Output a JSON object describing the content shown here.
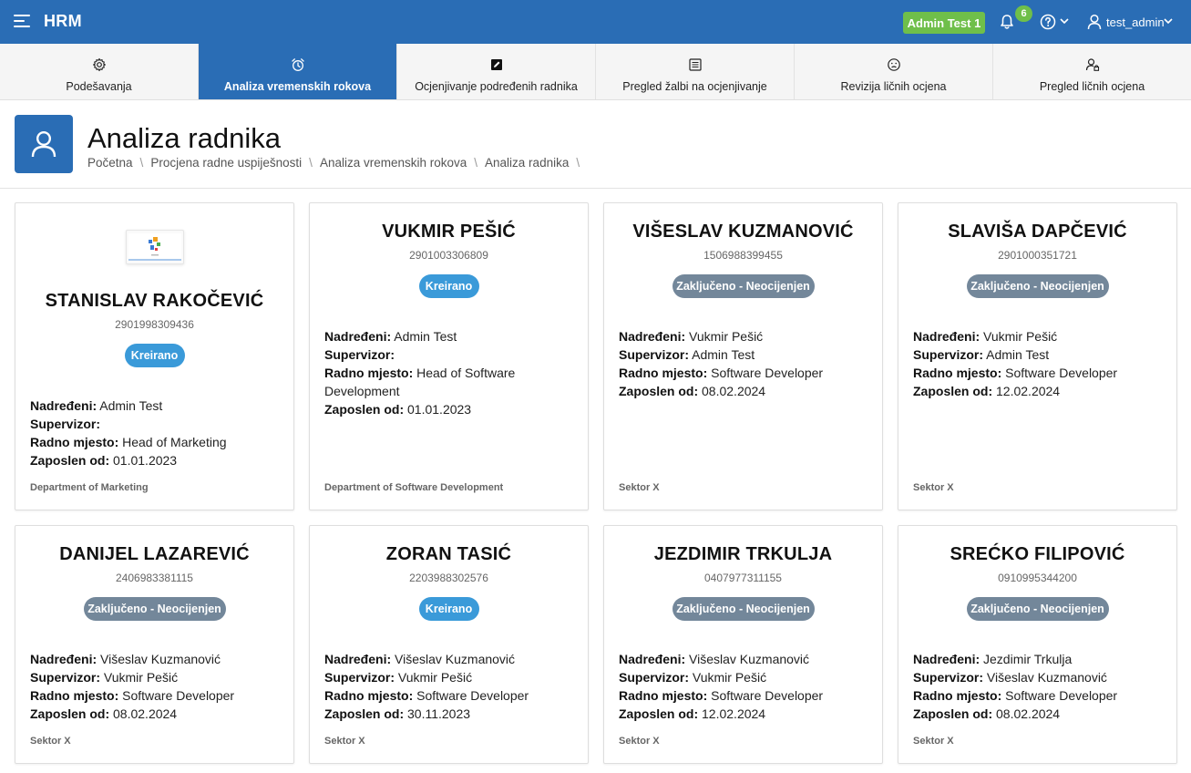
{
  "header": {
    "brand": "HRM",
    "admin_badge": "Admin Test 1",
    "notification_count": "6",
    "user_name": "test_admin",
    "accent_color": "#2a6db5"
  },
  "tabs": [
    {
      "label": "Podešavanja",
      "icon": "gear-icon",
      "active": false
    },
    {
      "label": "Analiza vremenskih rokova",
      "icon": "alarm-clock-icon",
      "active": true
    },
    {
      "label": "Ocjenjivanje podređenih radnika",
      "icon": "edit-icon",
      "active": false
    },
    {
      "label": "Pregled žalbi na ocjenjivanje",
      "icon": "list-icon",
      "active": false
    },
    {
      "label": "Revizija ličnih ocjena",
      "icon": "sad-face-icon",
      "active": false
    },
    {
      "label": "Pregled ličnih ocjena",
      "icon": "user-lock-icon",
      "active": false
    }
  ],
  "page": {
    "title": "Analiza radnika",
    "breadcrumb": [
      "Početna",
      "Procjena radne uspiješnosti",
      "Analiza vremenskih rokova",
      "Analiza radnika"
    ]
  },
  "labels": {
    "nadredjeni": "Nadređeni:",
    "supervizor": "Supervizor:",
    "radno_mjesto": "Radno mjesto:",
    "zaposlen_od": "Zaposlen od:"
  },
  "cards": [
    {
      "name": "STANISLAV RAKOČEVIĆ",
      "id": "2901998309436",
      "status": "Kreirano",
      "nadredjeni": "Admin Test",
      "supervizor": "",
      "radno_mjesto": "Head of Marketing",
      "zaposlen_od": "01.01.2023",
      "dept": "Department of Marketing"
    },
    {
      "name": "VUKMIR PEŠIĆ",
      "id": "2901003306809",
      "status": "Kreirano",
      "nadredjeni": "Admin Test",
      "supervizor": "",
      "radno_mjesto": "Head of Software Development",
      "zaposlen_od": "01.01.2023",
      "dept": "Department of Software Development"
    },
    {
      "name": "VIŠESLAV KUZMANOVIĆ",
      "id": "1506988399455",
      "status": "Zaključeno - Neocijenjen",
      "nadredjeni": "Vukmir Pešić",
      "supervizor": "Admin Test",
      "radno_mjesto": "Software Developer",
      "zaposlen_od": "08.02.2024",
      "dept": "Sektor X"
    },
    {
      "name": "SLAVIŠA DAPČEVIĆ",
      "id": "2901000351721",
      "status": "Zaključeno - Neocijenjen",
      "nadredjeni": "Vukmir Pešić",
      "supervizor": "Admin Test",
      "radno_mjesto": "Software Developer",
      "zaposlen_od": "12.02.2024",
      "dept": "Sektor X"
    },
    {
      "name": "DANIJEL LAZAREVIĆ",
      "id": "2406983381115",
      "status": "Zaključeno - Neocijenjen",
      "nadredjeni": "Višeslav Kuzmanović",
      "supervizor": "Vukmir Pešić",
      "radno_mjesto": "Software Developer",
      "zaposlen_od": "08.02.2024",
      "dept": "Sektor X"
    },
    {
      "name": "ZORAN TASIĆ",
      "id": "2203988302576",
      "status": "Kreirano",
      "nadredjeni": "Višeslav Kuzmanović",
      "supervizor": "Vukmir Pešić",
      "radno_mjesto": "Software Developer",
      "zaposlen_od": "30.11.2023",
      "dept": "Sektor X"
    },
    {
      "name": "JEZDIMIR TRKULJA",
      "id": "0407977311155",
      "status": "Zaključeno - Neocijenjen",
      "nadredjeni": "Višeslav Kuzmanović",
      "supervizor": "Vukmir Pešić",
      "radno_mjesto": "Software Developer",
      "zaposlen_od": "12.02.2024",
      "dept": "Sektor X"
    },
    {
      "name": "SREĆKO FILIPOVIĆ",
      "id": "0910995344200",
      "status": "Zaključeno - Neocijenjen",
      "nadredjeni": "Jezdimir Trkulja",
      "supervizor": "Višeslav Kuzmanović",
      "radno_mjesto": "Software Developer",
      "zaposlen_od": "08.02.2024",
      "dept": "Sektor X"
    }
  ]
}
